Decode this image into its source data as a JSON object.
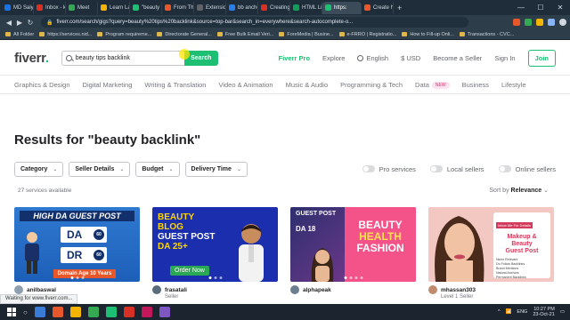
{
  "browser": {
    "tabs": [
      {
        "label": "MD Saiyi",
        "color": "#1a73e8"
      },
      {
        "label": "Inbox - ki",
        "color": "#d93025"
      },
      {
        "label": "Meet",
        "color": "#34a853"
      },
      {
        "label": "Learn Lan",
        "color": "#f4b400"
      },
      {
        "label": "\"beauty to",
        "color": "#1dbf73"
      },
      {
        "label": "From Thr",
        "color": "#e8572a"
      },
      {
        "label": "Extension",
        "color": "#5f6368"
      },
      {
        "label": "bb ancho",
        "color": "#2b7de9"
      },
      {
        "label": "Creating Y",
        "color": "#d93025"
      },
      {
        "label": "HTML Lin",
        "color": "#0f9d58"
      },
      {
        "label": "https:",
        "color": "#1dbf73",
        "active": true
      },
      {
        "label": "Create hy",
        "color": "#e8572a"
      }
    ],
    "new_tab": "+",
    "window_controls": [
      "—",
      "☐",
      "✕"
    ],
    "url": "fiverr.com/search/gigs?query=beauty%20tips%20backlink&source=top-bar&search_in=everywhere&search-autocomplete-o...",
    "bookmarks": [
      "All Folder",
      "https://services.nid...",
      "Program requireme...",
      "Directorate General...",
      "Free Bulk Email Veri...",
      "ForeMedia | Busine...",
      "e-FRRO | Registratio...",
      "How to Fill-up Onli...",
      "Transactions - CVC..."
    ]
  },
  "header": {
    "logo": "fiverr",
    "logo_dot": ".",
    "search_value": "beauty tips backlink",
    "search_button": "Search",
    "nav": {
      "pro": "Fiverr Pro",
      "explore": "Explore",
      "language": "English",
      "currency": "$ USD",
      "become_seller": "Become a Seller",
      "sign_in": "Sign In",
      "join": "Join"
    }
  },
  "categories": [
    "Graphics & Design",
    "Digital Marketing",
    "Writing & Translation",
    "Video & Animation",
    "Music & Audio",
    "Programming & Tech",
    "Data",
    "Business",
    "Lifestyle"
  ],
  "new_badge": "NEW",
  "results": {
    "title": "Results for \"beauty backlink\"",
    "filters": [
      "Category",
      "Seller Details",
      "Budget",
      "Delivery Time"
    ],
    "toggles": [
      "Pro services",
      "Local sellers",
      "Online sellers"
    ],
    "count": "27 services available",
    "sort_label": "Sort by",
    "sort_value": "Relevance"
  },
  "gigs": [
    {
      "seller": "anilbaswal",
      "level": "",
      "thumb_text": {
        "headline": "HIGH DA GUEST POST",
        "da": "DA",
        "dr": "DR",
        "dot_value": "60",
        "band": "Domain Age 10 Years"
      }
    },
    {
      "seller": "frasatali",
      "level": "Seller",
      "thumb_text": {
        "line1": "BEAUTY",
        "line2": "BLOG",
        "line3": "GUEST POST",
        "line4": "DA 25+",
        "order": "Order Now"
      }
    },
    {
      "seller": "alphapeak",
      "level": "",
      "thumb_text": {
        "cap": "GUEST POST",
        "badge": "DA 18",
        "big1": "BEAUTY",
        "big2": "HEALTH",
        "big3": "FASHION"
      }
    },
    {
      "seller": "mhassan303",
      "level": "Level 1 Seller",
      "thumb_text": {
        "tag": "Inbox Me For Details",
        "heading1": "Makeup &",
        "heading2": "Beauty",
        "heading3": "Guest Post",
        "items": [
          "Niche Relevant",
          "Do Follow Backlinks",
          "Brand Mentions",
          "Natural Anchors",
          "Permanent Backlinks"
        ]
      }
    }
  ],
  "status_url": "Waiting for www.fiverr.com...",
  "taskbar": {
    "lang": "ENG",
    "time": "10:27 PM",
    "date": "23-Oct-21",
    "app_colors": [
      "#3a7bd5",
      "#e8572a",
      "#f4b400",
      "#34a853",
      "#1dbf73",
      "#d93025",
      "#c2185b",
      "#7e57c2"
    ]
  },
  "colors": {
    "brand_green": "#1dbf73",
    "text_dark": "#222325",
    "muted": "#74767e"
  }
}
